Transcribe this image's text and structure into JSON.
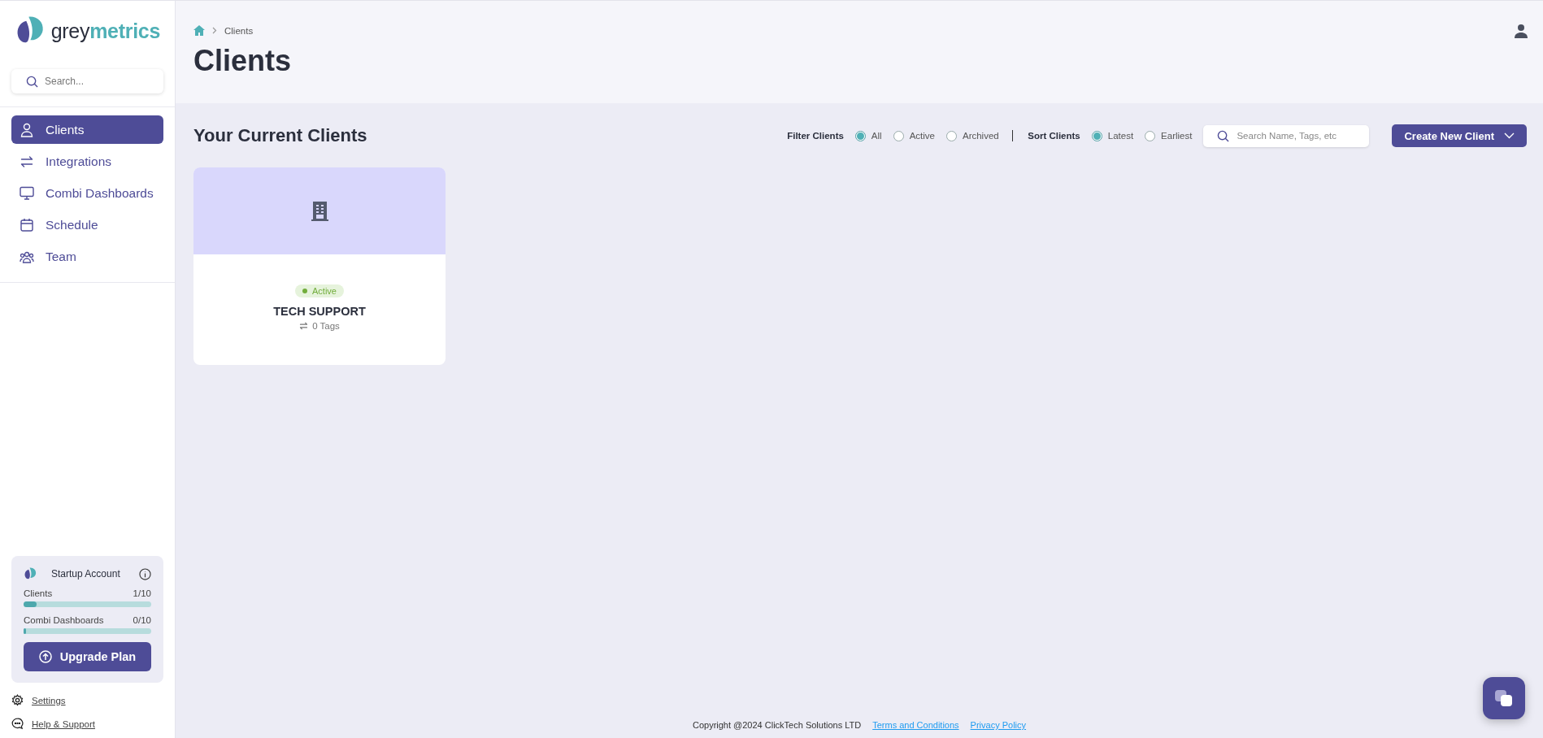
{
  "logo": {
    "text": "grey**metrics**"
  },
  "sidebar": {
    "search": {
      "placeholder": "Search..."
    },
    "items": [
      {
        "label": "Clients",
        "kind": "user",
        "selected": true
      },
      {
        "label": "Integrations",
        "kind": "swap",
        "selected": false
      },
      {
        "label": "Combi Dashboards",
        "kind": "monitor",
        "selected": false
      },
      {
        "label": "Schedule",
        "kind": "calendar",
        "selected": false
      },
      {
        "label": "Team",
        "kind": "team",
        "selected": false
      }
    ],
    "plan": {
      "title": "Startup Account",
      "meters": [
        {
          "label": "Clients",
          "reading": "1/10",
          "level": 0.1
        },
        {
          "label": "Combi Dashboards",
          "reading": "0/10",
          "level": 0
        }
      ],
      "button": "Upgrade Plan"
    },
    "links": [
      {
        "label": "Settings",
        "kind": "gear"
      },
      {
        "label": "Help & Support",
        "kind": "chat"
      }
    ]
  },
  "breadcrumb": [
    "Clients"
  ],
  "page_title": "Clients",
  "section_title": "Your Current Clients",
  "filter": {
    "label": "Filter Clients",
    "options": [
      {
        "label": "All",
        "selected": true
      },
      {
        "label": "Active",
        "selected": false
      },
      {
        "label": "Archived",
        "selected": false
      }
    ]
  },
  "sort": {
    "label": "Sort Clients",
    "options": [
      {
        "label": "Latest",
        "selected": true
      },
      {
        "label": "Earliest",
        "selected": false
      }
    ]
  },
  "search": {
    "placeholder": "Search Name, Tags, etc"
  },
  "create_button": "Create New Client",
  "clients": [
    {
      "status": "Active",
      "name": "TECH SUPPORT",
      "tags": "0 Tags"
    }
  ],
  "footer": {
    "copyright": "Copyright @2024 ClickTech Solutions LTD",
    "links": [
      "Terms and Conditions",
      "Privacy Policy"
    ]
  }
}
